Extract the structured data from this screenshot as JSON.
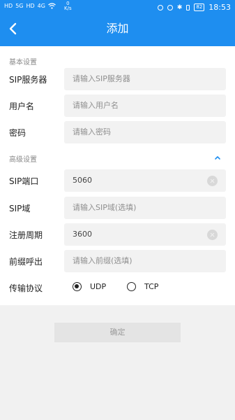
{
  "status_bar": {
    "left_net_1": "HD",
    "left_net_2": "5G",
    "left_net_3": "HD",
    "left_net_4": "4G",
    "speed_value": "0",
    "speed_unit": "K/s",
    "battery": "82",
    "time": "18:53"
  },
  "header": {
    "title": "添加"
  },
  "basic_section": {
    "title": "基本设置",
    "fields": [
      {
        "label": "SIP服务器",
        "placeholder": "请输入SIP服务器",
        "value": ""
      },
      {
        "label": "用户名",
        "placeholder": "请输入用户名",
        "value": ""
      },
      {
        "label": "密码",
        "placeholder": "请输入密码",
        "value": ""
      }
    ]
  },
  "advanced_section": {
    "title": "高级设置",
    "fields": [
      {
        "label": "SIP端口",
        "placeholder": "",
        "value": "5060"
      },
      {
        "label": "SIP域",
        "placeholder": "请输入SIP域(选填)",
        "value": ""
      },
      {
        "label": "注册周期",
        "placeholder": "",
        "value": "3600"
      },
      {
        "label": "前缀呼出",
        "placeholder": "请输入前缀(选填)",
        "value": ""
      }
    ],
    "transport": {
      "label": "传输协议",
      "options": [
        "UDP",
        "TCP"
      ],
      "selected": "UDP"
    }
  },
  "confirm_label": "确定",
  "colors": {
    "accent": "#1e8ef0",
    "field_bg": "#f2f2f2",
    "disabled_button": "#e4e4e4"
  }
}
